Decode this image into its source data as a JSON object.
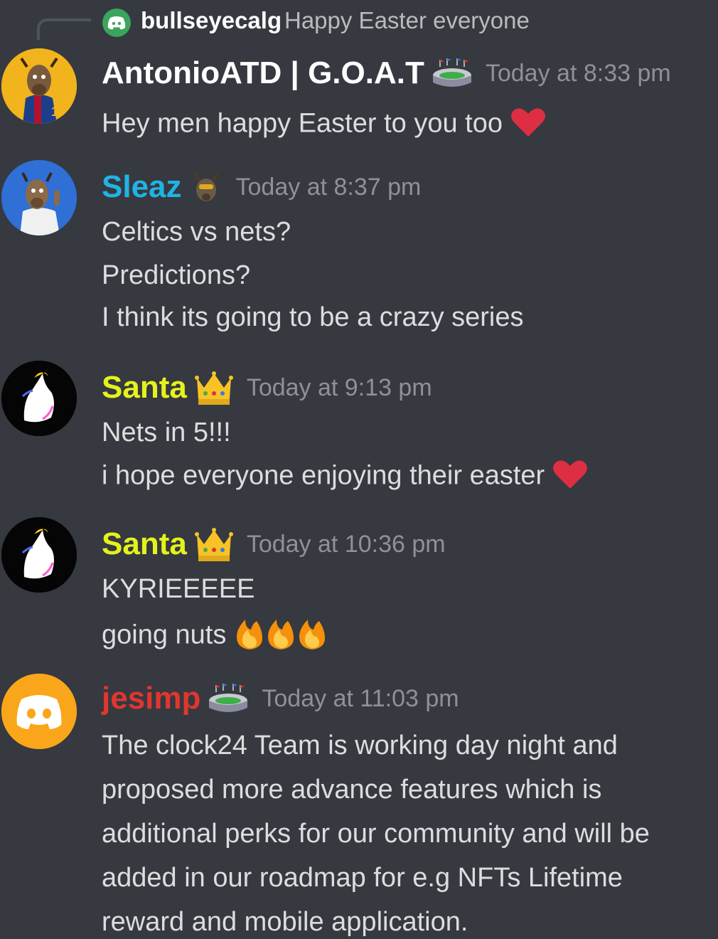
{
  "reply": {
    "username": "bullseyecalg",
    "text": "Happy Easter everyone"
  },
  "messages": [
    {
      "username": "AntonioATD | G.O.A.T",
      "username_color": "#ffffff",
      "badge": "stadium-icon",
      "timestamp": "Today at 8:33 pm",
      "lines": [
        "Hey men happy Easter to you too"
      ],
      "line_emojis": [
        "heart"
      ]
    },
    {
      "username": "Sleaz",
      "username_color": "#1fb4e6",
      "badge": "goat-icon",
      "timestamp": "Today at 8:37 pm",
      "lines": [
        "Celtics vs nets?",
        "Predictions?",
        "I think its going to be a crazy series"
      ]
    },
    {
      "username": "Santa",
      "username_color": "#e5f21b",
      "badge": "crown-icon",
      "timestamp": "Today at 9:13 pm",
      "lines": [
        "Nets in 5!!!",
        "i hope everyone enjoying their easter"
      ],
      "line_emojis": [
        "",
        "heart"
      ]
    },
    {
      "username": "Santa",
      "username_color": "#e5f21b",
      "badge": "crown-icon",
      "timestamp": "Today at 10:36 pm",
      "lines": [
        "KYRIEEEEE",
        "going nuts"
      ],
      "line_emojis": [
        "",
        "fire-x3"
      ]
    },
    {
      "username": "jesimp",
      "username_color": "#e0362f",
      "badge": "stadium-icon",
      "timestamp": "Today at 11:03 pm",
      "lines": [
        "The clock24 Team is working day night and",
        "proposed more advance features which is",
        "additional perks for our community and will be",
        "added in our roadmap for e.g NFTs Lifetime",
        "reward and mobile application."
      ]
    }
  ],
  "colors": {
    "background": "#36393f",
    "timestamp": "#8e9297",
    "text": "#dcddde"
  }
}
